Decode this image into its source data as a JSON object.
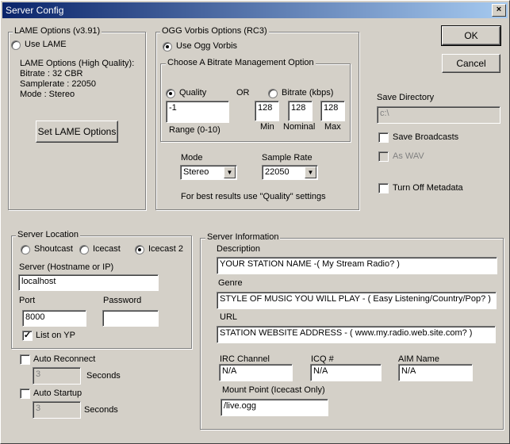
{
  "window": {
    "title": "Server Config"
  },
  "buttons": {
    "ok": "OK",
    "cancel": "Cancel",
    "set_lame": "Set LAME Options"
  },
  "lame": {
    "group_title": "LAME Options (v3.91)",
    "use_label": "Use LAME",
    "info_title": "LAME Options (High Quality):",
    "bitrate": "Bitrate : 32 CBR",
    "samplerate": "Samplerate : 22050",
    "mode": "Mode : Stereo"
  },
  "ogg": {
    "group_title": "OGG Vorbis Options (RC3)",
    "use_label": "Use Ogg Vorbis",
    "bitrate_group_title": "Choose A Bitrate Management Option",
    "quality_label": "Quality",
    "or_label": "OR",
    "bitrate_label": "Bitrate (kbps)",
    "quality_value": "-1",
    "range_label": "Range (0-10)",
    "min_value": "128",
    "nominal_value": "128",
    "max_value": "128",
    "min_label": "Min",
    "nominal_label": "Nominal",
    "max_label": "Max",
    "mode_label": "Mode",
    "mode_value": "Stereo",
    "samplerate_label": "Sample Rate",
    "samplerate_value": "22050",
    "hint": "For best results use \"Quality\" settings"
  },
  "save": {
    "dir_label": "Save Directory",
    "dir_value": "c:\\",
    "broadcasts_label": "Save Broadcasts",
    "wav_label": "As WAV",
    "metadata_label": "Turn Off Metadata"
  },
  "location": {
    "group_title": "Server Location",
    "shoutcast": "Shoutcast",
    "icecast": "Icecast",
    "icecast2": "Icecast 2",
    "server_label": "Server (Hostname or IP)",
    "server_value": "localhost",
    "port_label": "Port",
    "port_value": "8000",
    "password_label": "Password",
    "password_value": "",
    "yp_label": "List on YP"
  },
  "auto": {
    "reconnect_label": "Auto Reconnect",
    "reconnect_value": "3",
    "seconds1": "Seconds",
    "startup_label": "Auto Startup",
    "startup_value": "3",
    "seconds2": "Seconds"
  },
  "info": {
    "group_title": "Server Information",
    "description_label": "Description",
    "description_value": "YOUR STATION NAME -( My Stream Radio? )",
    "genre_label": "Genre",
    "genre_value": "STYLE OF MUSIC YOU WILL PLAY - ( Easy Listening/Country/Pop? )",
    "url_label": "URL",
    "url_value": "STATION WEBSITE ADDRESS - ( www.my.radio.web.site.com? )",
    "irc_label": "IRC Channel",
    "irc_value": "N/A",
    "icq_label": "ICQ #",
    "icq_value": "N/A",
    "aim_label": "AIM Name",
    "aim_value": "N/A",
    "mount_label": "Mount Point (Icecast Only)",
    "mount_value": "/live.ogg"
  }
}
